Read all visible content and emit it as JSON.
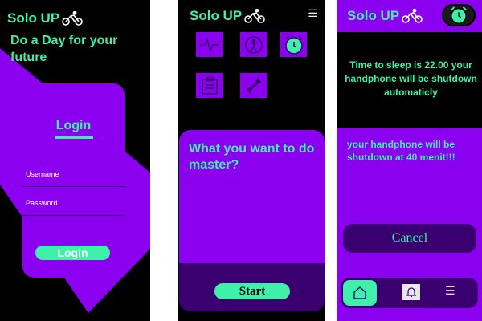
{
  "brand": {
    "name": "Solo UP",
    "icon": "cyclist-icon",
    "color": "#3ff0a8"
  },
  "colors": {
    "purple": "#8c00f0",
    "dark_purple": "#3a0070",
    "accent": "#3ff0a8",
    "background": "#000000"
  },
  "login_screen": {
    "tagline": "Do a Day for your future",
    "title": "Login",
    "username_label": "Username",
    "password_label": "Password",
    "button_label": "Login"
  },
  "home_screen": {
    "menu_icon": "hamburger-icon",
    "tiles": [
      {
        "icon": "heartbeat-icon"
      },
      {
        "icon": "accessibility-icon"
      },
      {
        "icon": "alarm-clock-icon"
      },
      {
        "icon": "clipboard-icon"
      },
      {
        "icon": "dumbbell-icon"
      }
    ],
    "question": "What you want to do master?",
    "start_label": "Start"
  },
  "alarm_screen": {
    "alarm_icon": "alarm-clock-icon",
    "sleep_message": "Time to sleep is 22.00 your handphone will be shutdown automaticly",
    "shutdown_message": "your handphone will be shutdown at 40 menit!!!",
    "cancel_label": "Cancel",
    "nav": [
      {
        "icon": "home-icon",
        "active": true
      },
      {
        "icon": "bell-icon",
        "active": false
      },
      {
        "icon": "hamburger-icon",
        "active": false
      }
    ]
  }
}
